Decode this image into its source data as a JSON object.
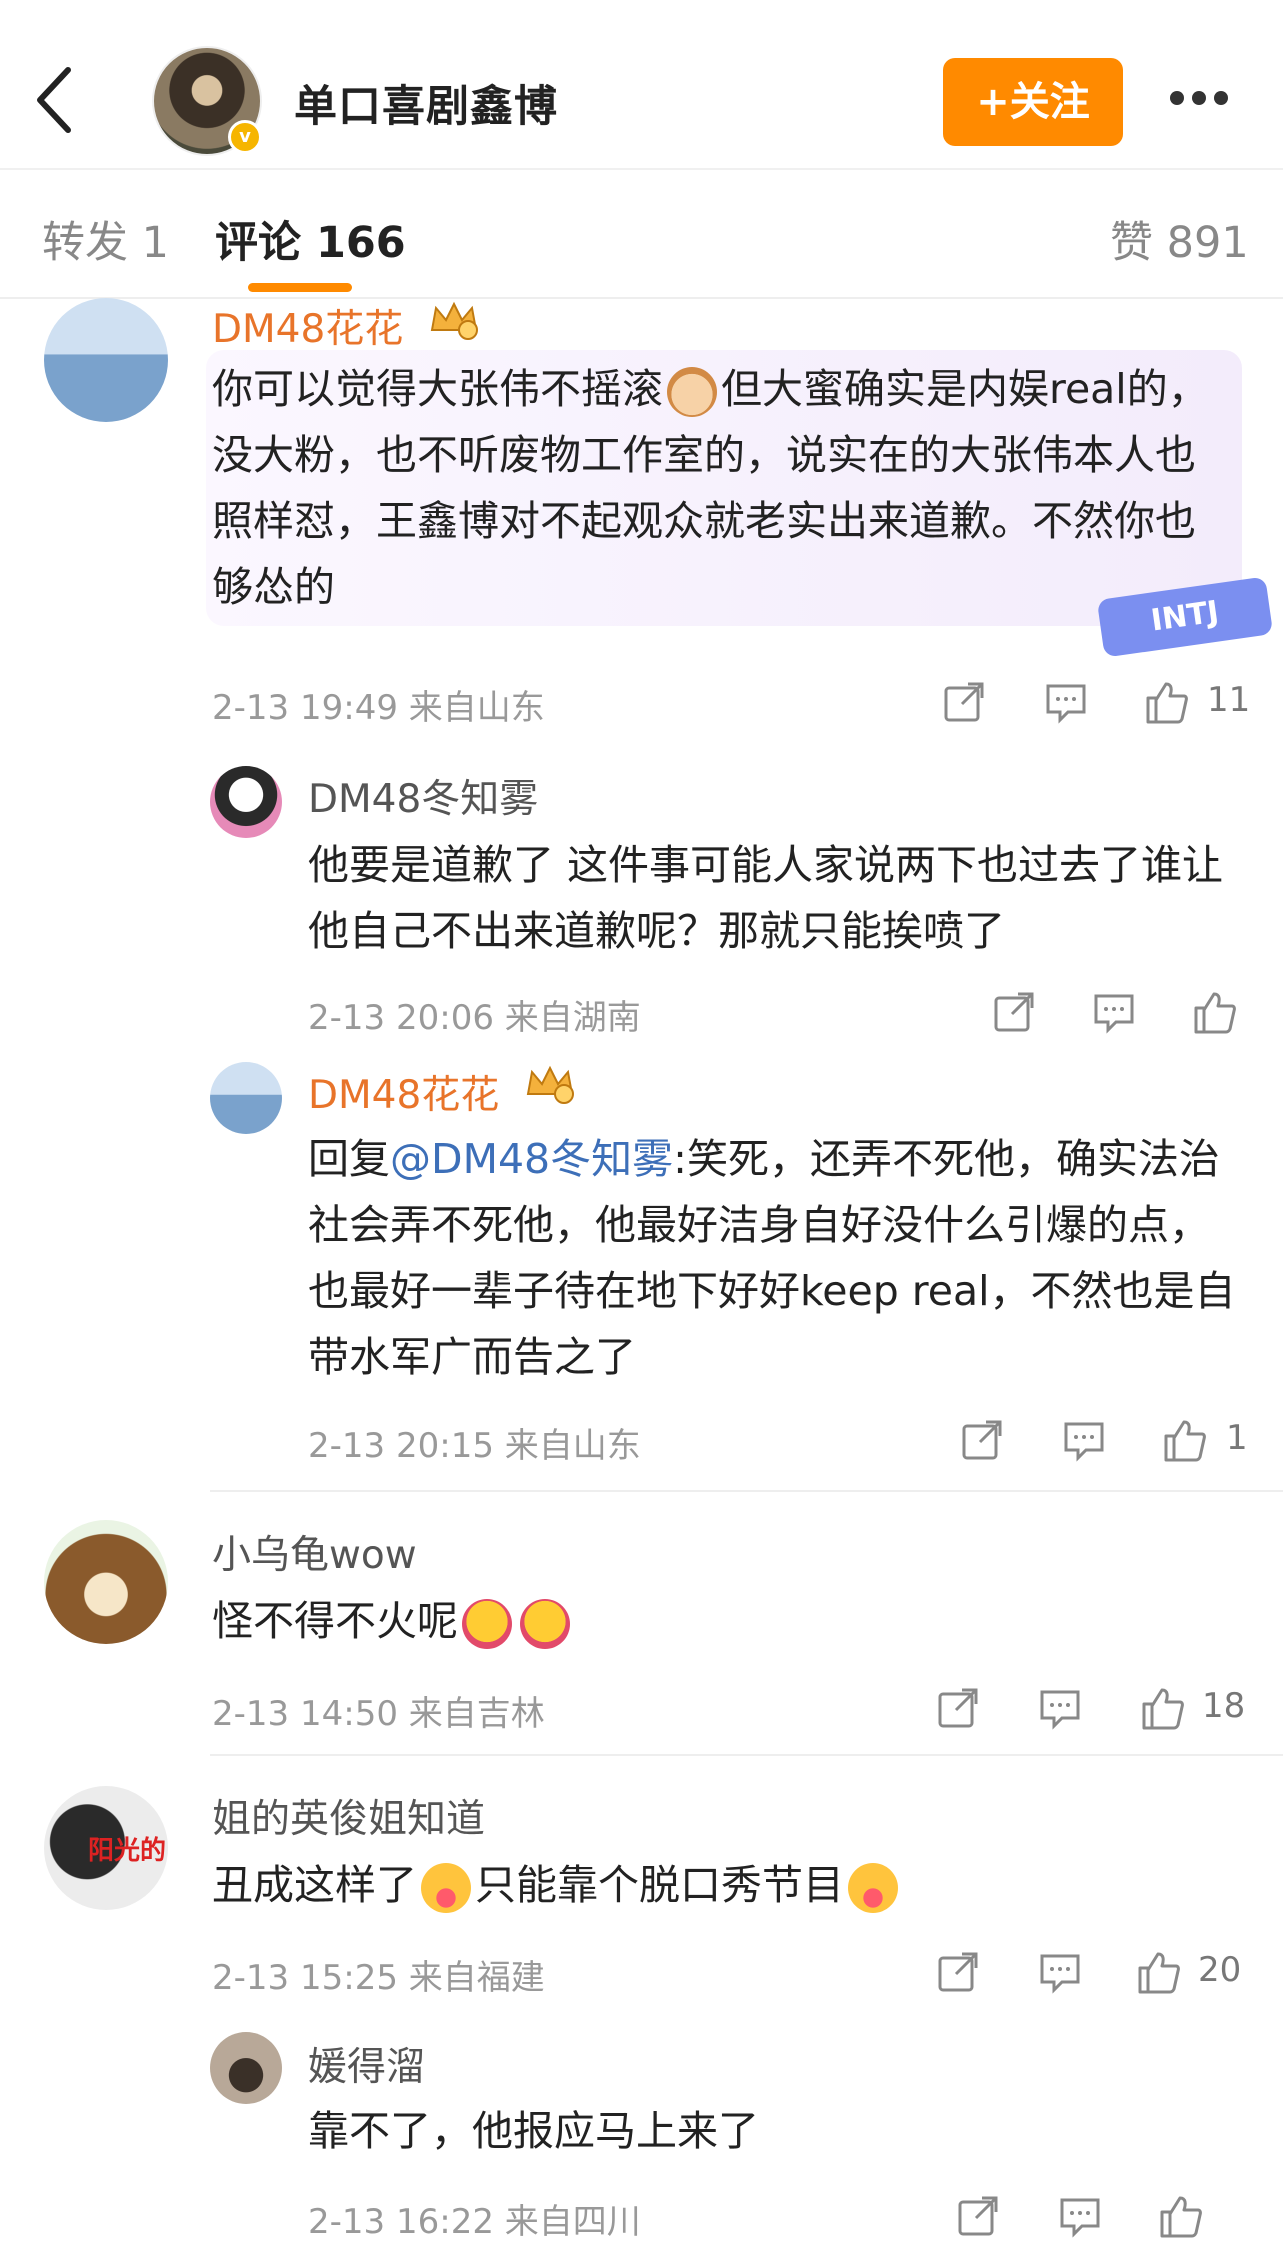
{
  "header": {
    "title": "单口喜剧鑫博",
    "follow_label": "+关注",
    "verified_mark": "v"
  },
  "tabs": {
    "repost": "转发 1",
    "comments": "评论 166",
    "likes": "赞 891"
  },
  "comments": [
    {
      "name": "DM48花花",
      "text": "你可以觉得大张伟不摇滚",
      "text2": "但大蜜确实是内娱real的，没大粉，也不听废物工作室的，说实在的大张伟本人也照样怼，王鑫博对不起观众就老实出来道歉。不然你也够怂的",
      "meta": "2-13 19:49 来自山东",
      "likes": "11",
      "sticker": "INTJ"
    },
    {
      "name": "DM48冬知雾",
      "text": "他要是道歉了 这件事可能人家说两下也过去了谁让他自己不出来道歉呢？那就只能挨喷了",
      "meta": "2-13 20:06 来自湖南",
      "likes": ""
    },
    {
      "name": "DM48花花",
      "reply_prefix": "回复",
      "mention": "@DM48冬知雾",
      "text": ":笑死，还弄不死他，确实法治社会弄不死他，他最好洁身自好没什么引爆的点，也最好一辈子待在地下好好keep real，不然也是自带水军广而告之了",
      "meta": "2-13 20:15 来自山东",
      "likes": "1"
    },
    {
      "name": "小乌龟wow",
      "text": "怪不得不火呢",
      "meta": "2-13 14:50 来自吉林",
      "likes": "18"
    },
    {
      "name": "姐的英俊姐知道",
      "text_a": "丑成这样了",
      "text_b": "只能靠个脱口秀节目",
      "meta": "2-13 15:25 来自福建",
      "likes": "20",
      "avatar_text": "阳光的"
    },
    {
      "name": "媛得溜",
      "text": "靠不了，他报应马上来了",
      "meta": "2-13 16:22 来自四川",
      "likes": ""
    }
  ],
  "icons": [
    "back-icon",
    "more-icon",
    "share-icon",
    "comment-icon",
    "like-icon",
    "crown-badge-icon"
  ],
  "colors": {
    "accent": "#ff8a00",
    "name_orange": "#e8742a",
    "mention": "#3d6fb8"
  }
}
